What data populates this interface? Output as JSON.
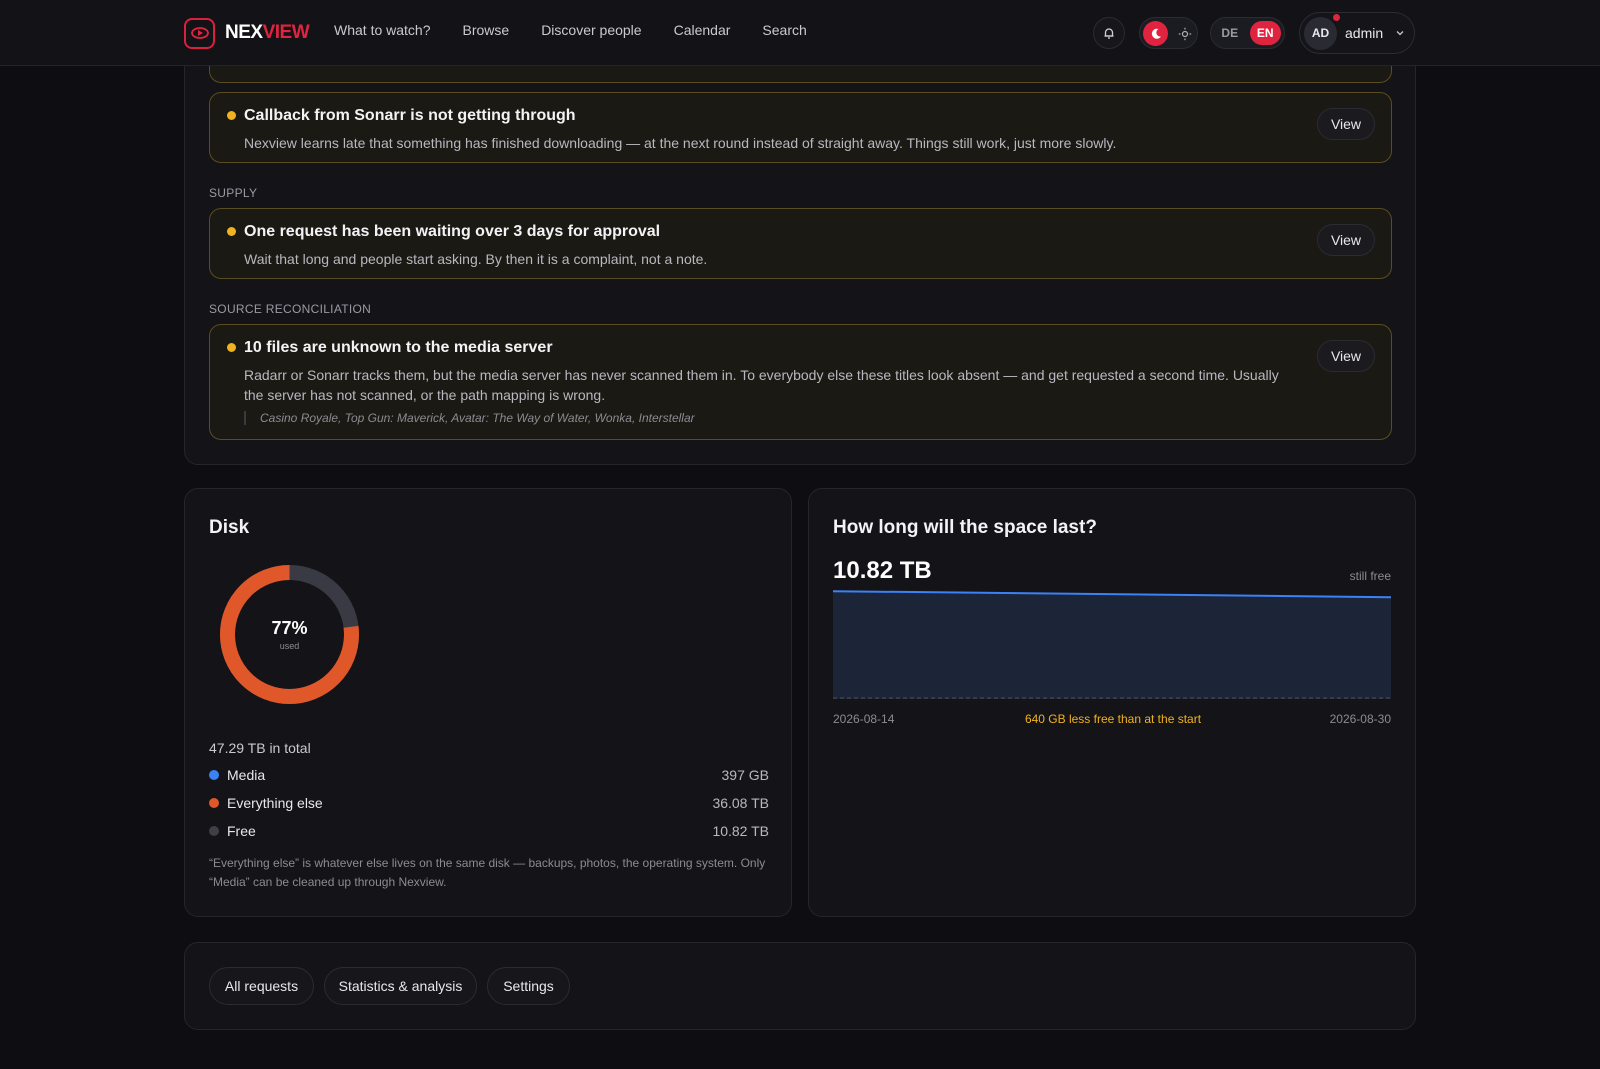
{
  "brand": {
    "name_part1": "NEX",
    "name_part2": "VIEW"
  },
  "nav": [
    {
      "label": "What to watch?"
    },
    {
      "label": "Browse"
    },
    {
      "label": "Discover people"
    },
    {
      "label": "Calendar"
    },
    {
      "label": "Search"
    }
  ],
  "language": {
    "options": [
      "DE",
      "EN"
    ],
    "active": "EN"
  },
  "user": {
    "initials": "AD",
    "name": "admin"
  },
  "alerts": {
    "callback": {
      "title": "Callback from Sonarr is not getting through",
      "description": "Nexview learns late that something has finished downloading — at the next round instead of straight away. Things still work, just more slowly.",
      "button": "View"
    },
    "supply_label": "SUPPLY",
    "supply": {
      "title": "One request has been waiting over 3 days for approval",
      "description": "Wait that long and people start asking. By then it is a complaint, not a note.",
      "button": "View"
    },
    "source_label": "SOURCE RECONCILIATION",
    "source": {
      "title": "10 files are unknown to the media server",
      "description": "Radarr or Sonarr tracks them, but the media server has never scanned them in. To everybody else these titles look absent — and get requested a second time. Usually the server has not scanned, or the path mapping is wrong.",
      "items": "Casino Royale, Top Gun: Maverick, Avatar: The Way of Water, Wonka, Interstellar",
      "button": "View"
    }
  },
  "disk": {
    "title": "Disk",
    "percent_label": "77%",
    "used_fraction": 0.77,
    "used_label": "used",
    "total": "47.29 TB in total",
    "legend": [
      {
        "name": "Media",
        "value": "397 GB",
        "color": "#3b82f6"
      },
      {
        "name": "Everything else",
        "value": "36.08 TB",
        "color": "#e0582a"
      },
      {
        "name": "Free",
        "value": "10.82 TB",
        "color": "#3f3f47"
      }
    ],
    "note": "“Everything else” is whatever else lives on the same disk — backups, photos, the operating system. Only “Media” can be cleaned up through Nexview."
  },
  "space": {
    "title": "How long will the space last?",
    "value": "10.82 TB",
    "value_caption": "still free",
    "x_start": "2026-08-14",
    "x_end": "2026-08-30",
    "delta_note": "640 GB less free than at the start"
  },
  "chart_data": {
    "type": "area",
    "x": [
      "2026-08-14",
      "2026-08-30"
    ],
    "y": [
      11.46,
      10.82
    ],
    "series": [
      {
        "values": [
          11.46,
          10.82
        ]
      }
    ],
    "ylim": [
      0,
      11.46
    ],
    "color": "#3b82f6"
  },
  "actions": [
    {
      "label": "All requests"
    },
    {
      "label": "Statistics & analysis"
    },
    {
      "label": "Settings"
    }
  ]
}
